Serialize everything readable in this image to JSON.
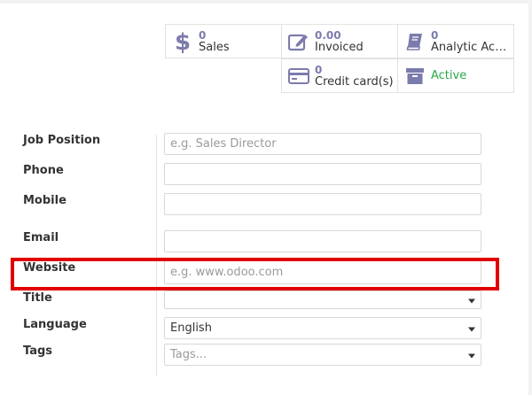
{
  "smart_buttons": {
    "sales": {
      "value": "0",
      "label": "Sales",
      "icon": "dollar-icon"
    },
    "invoiced": {
      "value": "0.00",
      "label": "Invoiced",
      "icon": "edit-icon"
    },
    "analytic": {
      "value": "0",
      "label": "Analytic Acc…",
      "icon": "book-icon"
    },
    "credit": {
      "value": "0",
      "label": "Credit card(s)",
      "icon": "credit-card-icon"
    },
    "active": {
      "label": "Active",
      "icon": "archive-icon"
    }
  },
  "form": {
    "job_position": {
      "label": "Job Position",
      "placeholder": "e.g. Sales Director"
    },
    "phone": {
      "label": "Phone"
    },
    "mobile": {
      "label": "Mobile"
    },
    "email": {
      "label": "Email"
    },
    "website": {
      "label": "Website",
      "placeholder": "e.g. www.odoo.com"
    },
    "title": {
      "label": "Title",
      "value": ""
    },
    "language": {
      "label": "Language",
      "value": "English"
    },
    "tags": {
      "label": "Tags",
      "placeholder": "Tags..."
    }
  },
  "colors": {
    "accent": "#7c7bad",
    "active": "#28a745",
    "highlight": "#e00000"
  }
}
